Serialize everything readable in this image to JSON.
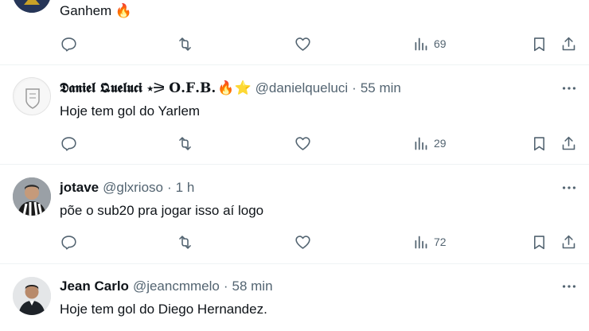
{
  "tweets": [
    {
      "text": "Ganhem 🔥",
      "stats": {
        "views": "69"
      }
    },
    {
      "name": "𝕯𝖆𝖓𝖎𝖊𝖑 𝕼𝖚𝖊𝖑𝖚𝖈𝖎 ⋆⚞ 𝐎.𝐅.𝐁.",
      "name_emojis": "🔥⭐",
      "handle": "@danielqueluci",
      "time": "55 min",
      "text": "Hoje tem gol do Yarlem",
      "stats": {
        "views": "29"
      }
    },
    {
      "name": "jotave",
      "handle": "@glxrioso",
      "time": "1 h",
      "text": "põe o sub20 pra jogar isso aí logo",
      "stats": {
        "views": "72"
      }
    },
    {
      "name": "Jean Carlo",
      "handle": "@jeancmmelo",
      "time": "58 min",
      "text": "Hoje tem gol do Diego Hernandez."
    }
  ],
  "separator_dot": "·",
  "colors": {
    "text": "#0f1419",
    "secondary": "#536471",
    "divider": "#eff3f4"
  }
}
